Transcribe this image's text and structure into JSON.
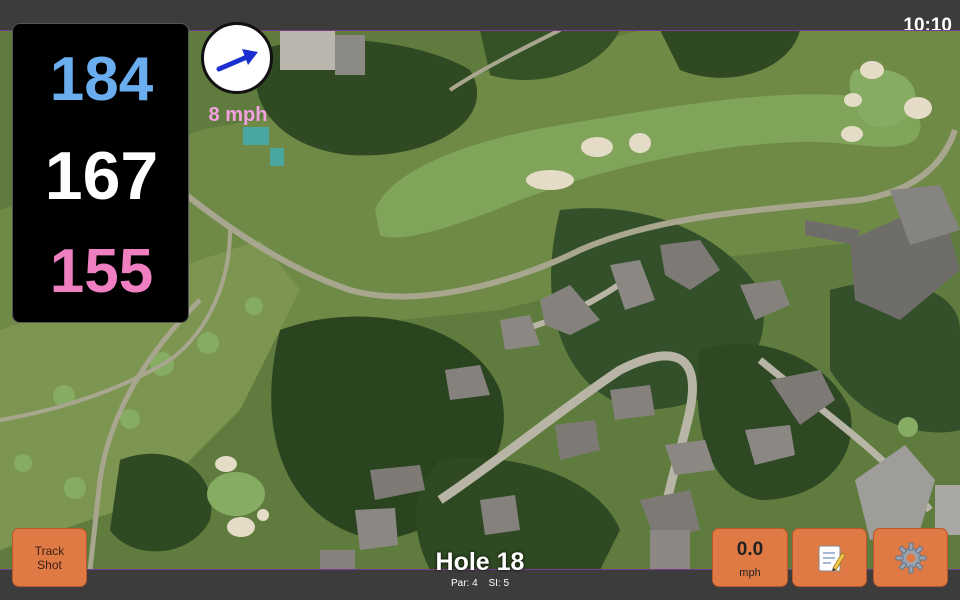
{
  "status_bar": {
    "time": "10:10"
  },
  "distances": {
    "back": {
      "value": "184",
      "color": "#6aaef0"
    },
    "middle": {
      "value": "167",
      "color": "#ffffff"
    },
    "front": {
      "value": "155",
      "color": "#ef7fc0"
    }
  },
  "wind": {
    "speed_label": "8 mph",
    "icon": "wind-direction-arrow-icon",
    "label_color": "#f2a0e0"
  },
  "hole": {
    "title": "Hole 18",
    "par": "Par: 4",
    "si": "SI: 5"
  },
  "buttons": {
    "track_shot": {
      "line1": "Track",
      "line2": "Shot"
    },
    "speed": {
      "value": "0.0",
      "unit": "mph"
    },
    "notes": {
      "icon": "notepad-icon"
    },
    "settings": {
      "icon": "gear-icon"
    }
  },
  "colors": {
    "button_accent": "#e07a45",
    "bar": "#3c3c3c"
  }
}
